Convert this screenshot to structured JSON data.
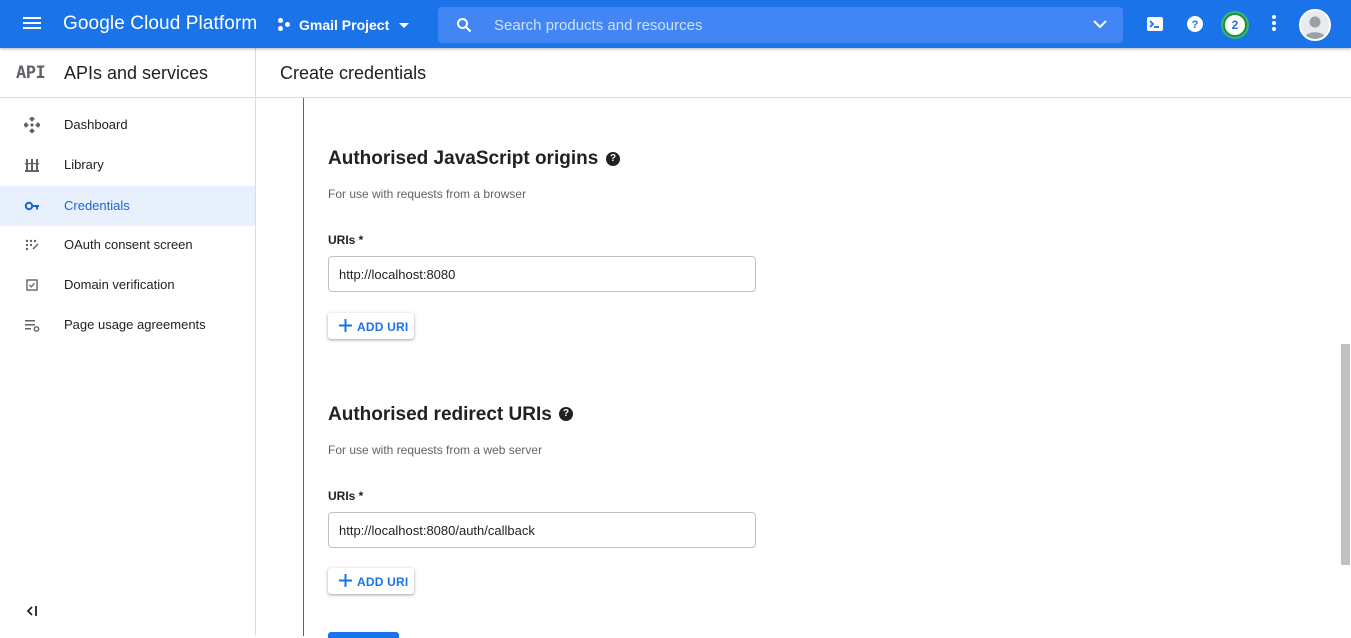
{
  "topbar": {
    "brand": "Google Cloud Platform",
    "project": "Gmail Project",
    "search_placeholder": "Search products and resources",
    "notification_count": "2"
  },
  "subheader": {
    "api_logo": "API",
    "section_title": "APIs and services",
    "page_title": "Create credentials"
  },
  "sidebar": {
    "items": [
      {
        "label": "Dashboard",
        "icon": "dashboard-icon"
      },
      {
        "label": "Library",
        "icon": "library-icon"
      },
      {
        "label": "Credentials",
        "icon": "key-icon",
        "active": true
      },
      {
        "label": "OAuth consent screen",
        "icon": "consent-icon"
      },
      {
        "label": "Domain verification",
        "icon": "checkbox-icon"
      },
      {
        "label": "Page usage agreements",
        "icon": "settings-list-icon"
      }
    ]
  },
  "origins": {
    "heading": "Authorised JavaScript origins",
    "hint": "For use with requests from a browser",
    "label": "URIs *",
    "value": "http://localhost:8080",
    "add_label": "ADD URI"
  },
  "redirects": {
    "heading": "Authorised redirect URIs",
    "hint": "For use with requests from a web server",
    "label": "URIs *",
    "value": "http://localhost:8080/auth/callback",
    "add_label": "ADD URI"
  },
  "colors": {
    "brand_blue": "#1a73e8",
    "search_blue": "#4285f4",
    "active_nav_bg": "#e8f0fe"
  }
}
